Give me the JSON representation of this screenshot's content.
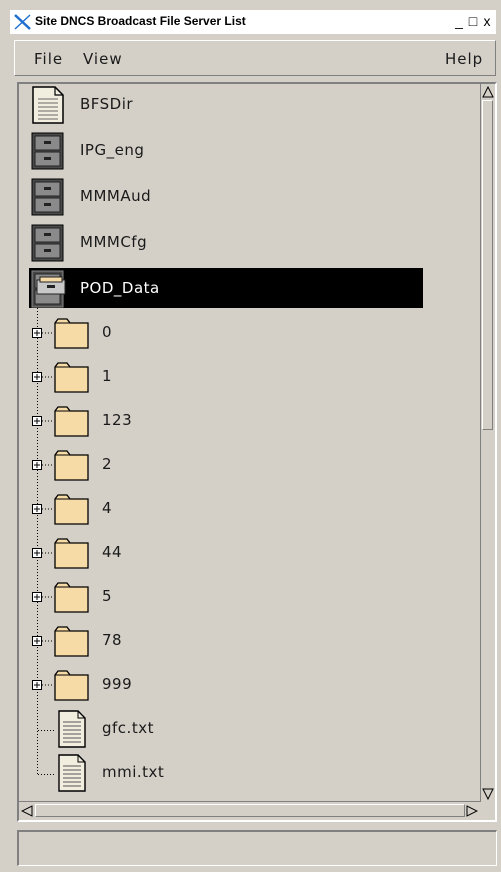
{
  "window": {
    "title": "Site DNCS Broadcast File Server List"
  },
  "titlebar_buttons": {
    "minimize": "_",
    "maximize": "□",
    "close": "x"
  },
  "menu": {
    "file": "File",
    "view": "View",
    "help": "Help"
  },
  "tree": {
    "servers": [
      {
        "label": "BFSDir",
        "icon": "document-icon"
      },
      {
        "label": "IPG_eng",
        "icon": "server-icon"
      },
      {
        "label": "MMMAud",
        "icon": "server-icon"
      },
      {
        "label": "MMMCfg",
        "icon": "server-icon"
      },
      {
        "label": "POD_Data",
        "icon": "open-server-icon",
        "selected": true
      }
    ],
    "children": [
      {
        "label": "0",
        "type": "folder"
      },
      {
        "label": "1",
        "type": "folder"
      },
      {
        "label": "123",
        "type": "folder"
      },
      {
        "label": "2",
        "type": "folder"
      },
      {
        "label": "4",
        "type": "folder"
      },
      {
        "label": "44",
        "type": "folder"
      },
      {
        "label": "5",
        "type": "folder"
      },
      {
        "label": "78",
        "type": "folder"
      },
      {
        "label": "999",
        "type": "folder"
      },
      {
        "label": "gfc.txt",
        "type": "file"
      },
      {
        "label": "mmi.txt",
        "type": "file"
      }
    ]
  },
  "colors": {
    "selection": "#000000",
    "folder": "#f7dba6",
    "window_bg": "#d4d0c8"
  },
  "status": {
    "text": ""
  }
}
